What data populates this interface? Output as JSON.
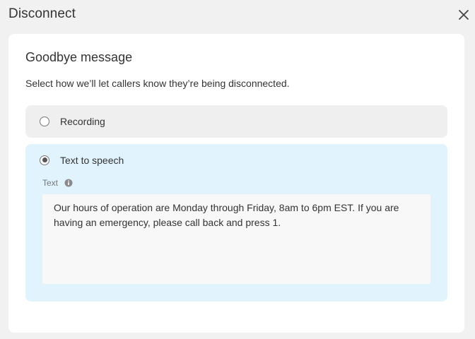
{
  "dialog": {
    "title": "Disconnect",
    "close_icon": "close-icon"
  },
  "goodbye": {
    "title": "Goodbye message",
    "description": "Select how we’ll let callers know they’re being disconnected."
  },
  "options": [
    {
      "label": "Recording",
      "selected": false
    },
    {
      "label": "Text to speech",
      "selected": true
    }
  ],
  "tts": {
    "field_label": "Text",
    "info_icon": "info-icon",
    "text": "Our hours of operation are Monday through Friday, 8am to 6pm EST. If you are having an emergency, please call back and press 1."
  },
  "colors": {
    "background": "#f1f1f1",
    "selected_option_bg": "#e1f3fd",
    "unselected_option_bg": "#efefef"
  }
}
